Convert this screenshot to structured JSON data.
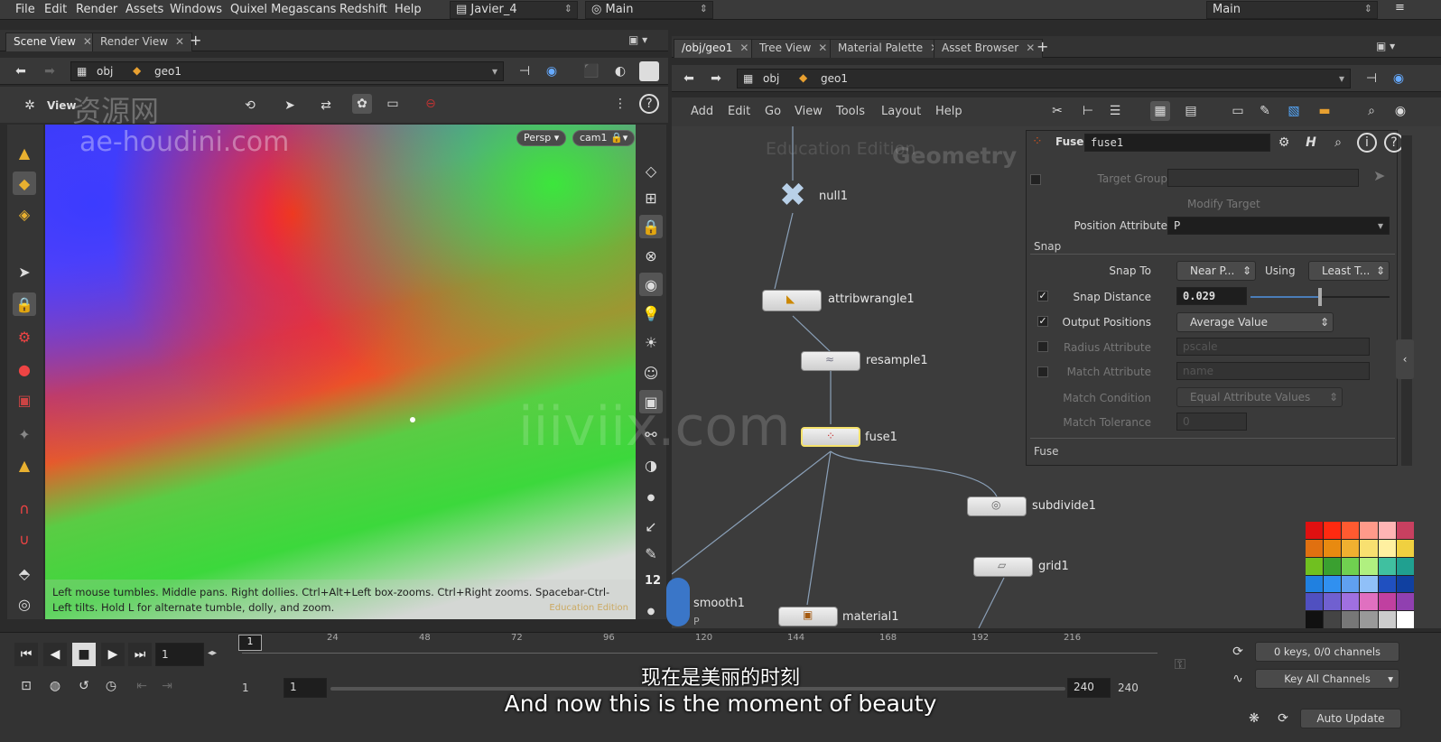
{
  "menu": [
    "File",
    "Edit",
    "Render",
    "Assets",
    "Windows",
    "Quixel Megascans",
    "Redshift",
    "Help"
  ],
  "desktop": "Javier_4",
  "context": "Main",
  "context_right": "Main",
  "left_tabs": [
    "Scene View",
    "Render View"
  ],
  "left_path": {
    "obj": "obj",
    "geo": "geo1"
  },
  "view_label": "View",
  "watermark_top": "资源网",
  "watermark_url": "ae-houdini.com",
  "viewport": {
    "persp": "Persp",
    "cam": "cam1",
    "hud": "Left mouse tumbles. Middle pans. Right dollies. Ctrl+Alt+Left box-zooms. Ctrl+Right zooms. Spacebar-Ctrl-Left tilts. Hold L for alternate tumble, dolly, and zoom.",
    "edu": "Education Edition"
  },
  "right_tabs": [
    "/obj/geo1",
    "Tree View",
    "Material Palette",
    "Asset Browser"
  ],
  "right_path": {
    "obj": "obj",
    "geo": "geo1"
  },
  "net_menu": [
    "Add",
    "Edit",
    "Go",
    "View",
    "Tools",
    "Layout",
    "Help"
  ],
  "net_edu": "Education Edition",
  "net_title": "Geometry",
  "net_watermark": "iiiviix.com",
  "nodes": {
    "null": "null1",
    "wrangle": "attribwrangle1",
    "resample": "resample1",
    "fuse": "fuse1",
    "subdivide": "subdivide1",
    "grid": "grid1",
    "smooth": "smooth1",
    "smooth_sub": "P",
    "material": "material1"
  },
  "params": {
    "type": "Fuse",
    "name": "fuse1",
    "target_group": "Target Group",
    "modify_target": "Modify Target",
    "position_attribute": "Position Attribute",
    "position_value": "P",
    "snap_header": "Snap",
    "snap_to": "Snap To",
    "snap_to_val": "Near P...",
    "using": "Using",
    "using_val": "Least T...",
    "snap_distance": "Snap Distance",
    "snap_distance_val": "0.029",
    "snap_distance_frac": 0.5,
    "output_positions": "Output Positions",
    "output_val": "Average Value",
    "radius_attribute": "Radius Attribute",
    "radius_val": "pscale",
    "match_attribute": "Match Attribute",
    "match_val": "name",
    "match_condition": "Match Condition",
    "match_cond_val": "Equal Attribute Values",
    "match_tolerance": "Match Tolerance",
    "match_tol_val": "0",
    "fuse_header": "Fuse"
  },
  "timeline": {
    "frame": "1",
    "ticks": [
      "24",
      "48",
      "72",
      "96",
      "120",
      "144",
      "168",
      "192",
      "216"
    ],
    "start": "1",
    "start2": "1",
    "end": "240",
    "end2": "240",
    "marker": "1",
    "keys": "0 keys, 0/0 channels",
    "key_all": "Key All Channels",
    "auto_update": "Auto Update"
  },
  "left_tools_count": "12",
  "subtitle_cn": "现在是美丽的时刻",
  "subtitle_en": "And now this is the moment of beauty",
  "swatch_colors": [
    "#e01010",
    "#ff2a10",
    "#ff5a30",
    "#ff9a8a",
    "#ffb4b4",
    "#c84060",
    "#e07010",
    "#e88a10",
    "#f0b030",
    "#f8e070",
    "#fff0a0",
    "#f0d040",
    "#70c020",
    "#3aa030",
    "#70d050",
    "#b0f080",
    "#40c0a0",
    "#20a090",
    "#2080e0",
    "#3090f0",
    "#60a0f0",
    "#90c0f8",
    "#2050c0",
    "#1040a0",
    "#5050c0",
    "#7060d0",
    "#a070e0",
    "#e070c0",
    "#c040a0",
    "#9040b0",
    "#111111",
    "#444444",
    "#777777",
    "#999999",
    "#cccccc",
    "#ffffff"
  ]
}
